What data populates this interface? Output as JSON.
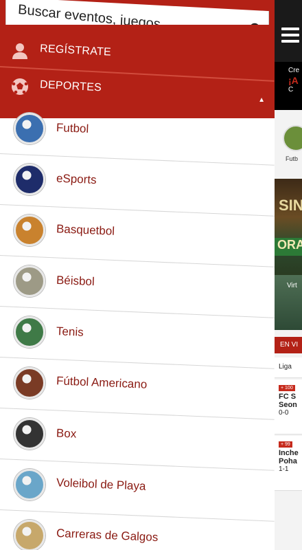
{
  "search": {
    "placeholder": "Buscar eventos, juegos"
  },
  "menu": {
    "register_label": "REGÍSTRATE",
    "sports_label": "DEPORTES",
    "sports": [
      {
        "label": "Futbol",
        "icon": "soccer-thumb",
        "color": "#3b6fb0"
      },
      {
        "label": "eSports",
        "icon": "esports-thumb",
        "color": "#1e2c6a"
      },
      {
        "label": "Basquetbol",
        "icon": "basketball-thumb",
        "color": "#c9822e"
      },
      {
        "label": "Béisbol",
        "icon": "baseball-thumb",
        "color": "#9d9a86"
      },
      {
        "label": "Tenis",
        "icon": "tennis-thumb",
        "color": "#3f7a47"
      },
      {
        "label": "Fútbol Americano",
        "icon": "american-football-thumb",
        "color": "#7a3b25"
      },
      {
        "label": "Box",
        "icon": "boxing-thumb",
        "color": "#333333"
      },
      {
        "label": "Voleibol de Playa",
        "icon": "beach-volleyball-thumb",
        "color": "#6aa6c9"
      },
      {
        "label": "Carreras de Galgos",
        "icon": "greyhound-thumb",
        "color": "#c7a86b"
      }
    ]
  },
  "background_app": {
    "promo_line1": "Cre",
    "promo_line2": "¡A",
    "promo_line3": "C",
    "thumb_caption": "Futb",
    "casino_text": "SIN",
    "casino_banner": "ORA",
    "virtual_text": "Virt",
    "live_label": "EN VI",
    "league_text": "Liga",
    "rows": [
      {
        "badge": "+ 100",
        "team1": "FC S",
        "team2": "Seon",
        "score": "0-0"
      },
      {
        "badge": "+ 99",
        "team1": "Inche",
        "team2": "Poha",
        "score": "1-1"
      }
    ]
  },
  "colors": {
    "brand_red": "#b32116",
    "label_red": "#8a1a12",
    "background": "#ffffff"
  }
}
